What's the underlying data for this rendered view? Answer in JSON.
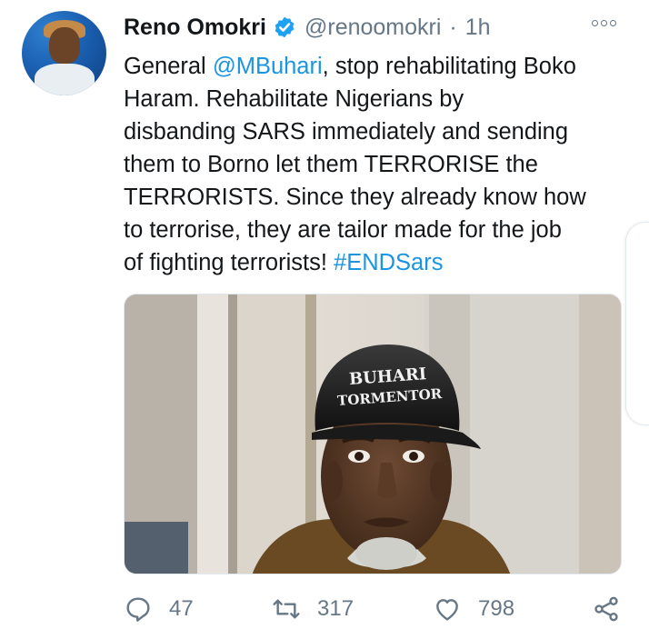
{
  "tweet": {
    "author_name": "Reno Omokri",
    "handle": "@renoomokri",
    "separator": "·",
    "time": "1h",
    "text_lines": [
      {
        "before": "General ",
        "mention": "@MBuhari",
        "after": ", stop rehabilitating Boko"
      },
      {
        "text": "Haram. Rehabilitate Nigerians by"
      },
      {
        "text": "disbanding SARS immediately and sending"
      },
      {
        "text": "them to Borno let them TERRORISE the"
      },
      {
        "text": "TERRORISTS. Since they already know how"
      },
      {
        "text": "to terrorise, they are tailor made for the job"
      },
      {
        "before": "of fighting terrorists! ",
        "hashtag": "#ENDSars"
      }
    ],
    "image": {
      "cap_text_line1": "BUHARI",
      "cap_text_line2": "TORMENTOR"
    },
    "actions": {
      "reply_count": "47",
      "retweet_count": "317",
      "like_count": "798"
    }
  },
  "colors": {
    "link": "#1b95e0",
    "secondary_text": "#657786",
    "verified_badge": "#1da1f2"
  },
  "icons": [
    "verified-badge-icon",
    "more-options-icon",
    "reply-icon",
    "retweet-icon",
    "like-icon",
    "share-icon"
  ]
}
